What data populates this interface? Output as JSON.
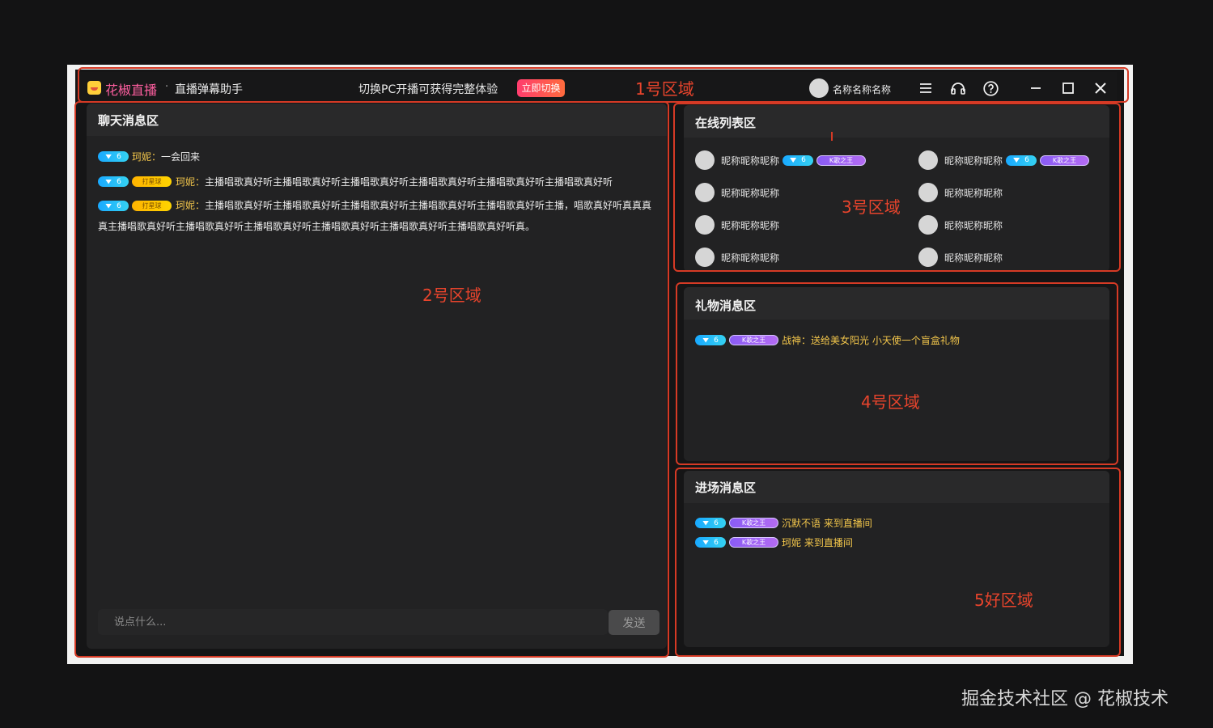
{
  "titlebar": {
    "brand": "花椒直播",
    "separator": "·",
    "subtitle": "直播弹幕助手",
    "promo_text": "切换PC开播可获得完整体验",
    "promo_button": "立即切换",
    "user_name": "名称名称名称",
    "icons": [
      "logo-icon",
      "menu-icon",
      "headset-icon",
      "help-icon",
      "minimize-icon",
      "maximize-icon",
      "close-icon"
    ]
  },
  "annotations": {
    "zone1": "1号区域",
    "zone2": "2号区域",
    "zone3": "3号区域",
    "zone4": "4号区域",
    "zone5": "5好区域"
  },
  "chat": {
    "title": "聊天消息区",
    "messages": [
      {
        "level": "6",
        "badge": "",
        "name": "珂妮：",
        "text": "一会回来"
      },
      {
        "level": "6",
        "badge": "打星球",
        "name": "珂妮：",
        "text": "主播唱歌真好听主播唱歌真好听主播唱歌真好听主播唱歌真好听主播唱歌真好听主播唱歌真好听"
      },
      {
        "level": "6",
        "badge": "打星球",
        "name": "珂妮：",
        "text": "主播唱歌真好听主播唱歌真好听主播唱歌真好听主播唱歌真好听主播唱歌真好听主播，唱歌真好听真真真真主播唱歌真好听主播唱歌真好听主播唱歌真好听主播唱歌真好听主播唱歌真好听主播唱歌真好听真。"
      }
    ],
    "input_placeholder": "说点什么...",
    "send_label": "发送"
  },
  "online": {
    "title": "在线列表区",
    "level": "6",
    "badge": "K歌之王",
    "users": [
      {
        "name": "昵称昵称昵称",
        "badges": true
      },
      {
        "name": "昵称昵称昵称",
        "badges": true
      },
      {
        "name": "昵称昵称昵称",
        "badges": false
      },
      {
        "name": "昵称昵称昵称",
        "badges": false
      },
      {
        "name": "昵称昵称昵称",
        "badges": false
      },
      {
        "name": "昵称昵称昵称",
        "badges": false
      },
      {
        "name": "昵称昵称昵称",
        "badges": false
      },
      {
        "name": "昵称昵称昵称",
        "badges": false
      }
    ]
  },
  "gift": {
    "title": "礼物消息区",
    "messages": [
      {
        "level": "6",
        "badge": "K歌之王",
        "text": "战神：送给美女阳光 小天使一个盲盒礼物"
      }
    ]
  },
  "enter": {
    "title": "进场消息区",
    "messages": [
      {
        "level": "6",
        "badge": "K歌之王",
        "text": "沉默不语 来到直播间"
      },
      {
        "level": "6",
        "badge": "K歌之王",
        "text": "珂妮 来到直播间"
      }
    ]
  },
  "watermark": "掘金技术社区 @ 花椒技术",
  "colors": {
    "accent_pink": "#ff5fa0",
    "annotation_red": "#d63a25",
    "name_yellow": "#f3c64b",
    "panel_bg": "#222223"
  }
}
